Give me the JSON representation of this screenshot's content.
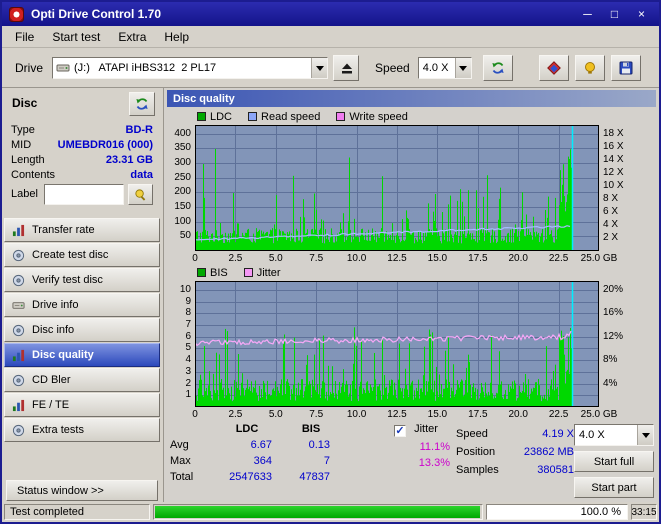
{
  "window": {
    "title": "Opti Drive Control 1.70",
    "buttons": {
      "minimize": "─",
      "maximize": "□",
      "close": "×"
    }
  },
  "menu": {
    "items": [
      "File",
      "Start test",
      "Extra",
      "Help"
    ]
  },
  "toolbar": {
    "drive_label": "Drive",
    "drive_value": "(J:)   ATAPI iHBS312  2 PL17",
    "speed_label": "Speed",
    "speed_value": "4.0 X"
  },
  "sidebar": {
    "header": "Disc",
    "fields": [
      {
        "label": "Type",
        "value": "BD-R"
      },
      {
        "label": "MID",
        "value": "UMEBDR016 (000)"
      },
      {
        "label": "Length",
        "value": "23.31 GB"
      },
      {
        "label": "Contents",
        "value": "data"
      }
    ],
    "label_label": "Label",
    "label_value": "",
    "buttons": [
      "Transfer rate",
      "Create test disc",
      "Verify test disc",
      "Drive info",
      "Disc info",
      "Disc quality",
      "CD Bler",
      "FE / TE",
      "Extra tests"
    ],
    "active_button": "Disc quality",
    "status_window": "Status window >>"
  },
  "main": {
    "header": "Disc quality",
    "legend_top": [
      {
        "label": "LDC",
        "color": "#00a800"
      },
      {
        "label": "Read speed",
        "color": "#8ca6f8"
      },
      {
        "label": "Write speed",
        "color": "#f07df0"
      }
    ],
    "legend_bottom": [
      {
        "label": "BIS",
        "color": "#00a800"
      },
      {
        "label": "Jitter",
        "color": "#f598f5"
      }
    ]
  },
  "charts": {
    "plot_bg": "#8295b8",
    "grid_color": "#5e7199",
    "bar_color": "#00d800",
    "capacity_line": "#00eeff",
    "capacity_frac": 0.9324,
    "x_tick_labels": [
      "0",
      "2.5",
      "5.0",
      "7.5",
      "10.0",
      "12.5",
      "15.0",
      "17.5",
      "20.0",
      "22.5",
      "25.0 GB"
    ],
    "top": {
      "left_tick_values": [
        50,
        100,
        150,
        200,
        250,
        300,
        350,
        400
      ],
      "left_tick_labels": [
        "50",
        "100",
        "150",
        "200",
        "250",
        "300",
        "350",
        "400"
      ],
      "left_max": 430,
      "right_tick_values": [
        2,
        4,
        6,
        8,
        10,
        12,
        14,
        16,
        18
      ],
      "right_tick_labels": [
        "2 X",
        "4 X",
        "6 X",
        "8 X",
        "10 X",
        "12 X",
        "14 X",
        "16 X",
        "18 X"
      ],
      "right_max": 19.4,
      "line_color": "#a6bcff"
    },
    "bottom": {
      "left_tick_values": [
        1,
        2,
        3,
        4,
        5,
        6,
        7,
        8,
        9,
        10
      ],
      "left_tick_labels": [
        "1",
        "2",
        "3",
        "4",
        "5",
        "6",
        "7",
        "8",
        "9",
        "10"
      ],
      "left_max": 10.75,
      "right_tick_values": [
        4,
        8,
        12,
        16,
        20
      ],
      "right_tick_labels": [
        "4%",
        "8%",
        "12%",
        "16%",
        "20%"
      ],
      "right_max": 21.5,
      "line_color": "#f8a8f8"
    }
  },
  "results": {
    "col_ldc": "LDC",
    "col_bis": "BIS",
    "rows": [
      {
        "label": "Avg",
        "ldc": "6.67",
        "bis": "0.13"
      },
      {
        "label": "Max",
        "ldc": "364",
        "bis": "7"
      },
      {
        "label": "Total",
        "ldc": "2547633",
        "bis": "47837"
      }
    ],
    "jitter_label": "Jitter",
    "jitter_checked": true,
    "check_glyph": "✓",
    "jitter_values": [
      "11.1%",
      "13.3%"
    ],
    "stats": [
      {
        "label": "Speed",
        "value": "4.19 X"
      },
      {
        "label": "Position",
        "value": "23862 MB"
      },
      {
        "label": "Samples",
        "value": "380581"
      }
    ],
    "speed_select": "4.0 X",
    "start_full": "Start full",
    "start_part": "Start part"
  },
  "statusbar": {
    "text": "Test completed",
    "percent": "100.0 %",
    "time": "33:15"
  }
}
